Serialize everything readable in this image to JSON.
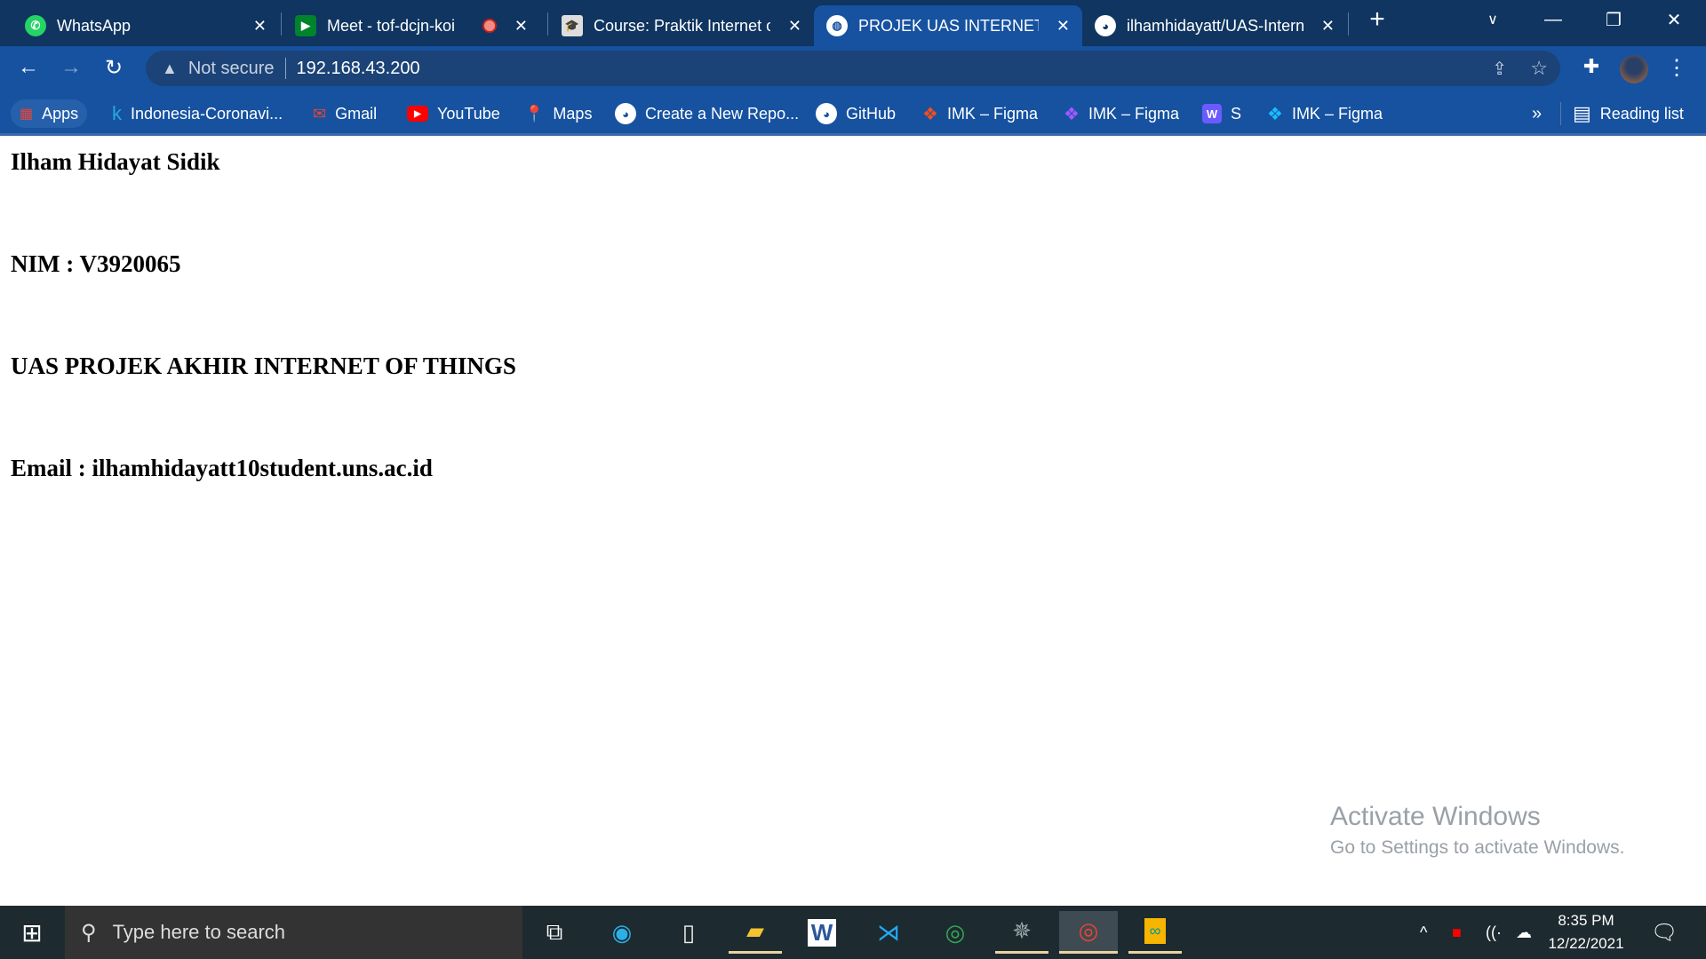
{
  "browser": {
    "tabs": [
      {
        "title": "WhatsApp",
        "icon": "whatsapp-icon",
        "active": false
      },
      {
        "title": "Meet - tof-dcjn-koi",
        "icon": "google-meet-icon",
        "active": false,
        "recording": true
      },
      {
        "title": "Course: Praktik Internet of",
        "icon": "moodle-course-icon",
        "active": false
      },
      {
        "title": "PROJEK UAS INTERNET OF",
        "icon": "globe-icon",
        "active": true
      },
      {
        "title": "ilhamhidayatt/UAS-Intern",
        "icon": "github-icon",
        "active": false
      }
    ],
    "close_glyph": "✕",
    "new_tab": "+",
    "security_label": "Not secure",
    "url": "192.168.43.200",
    "bookmarks": [
      {
        "label": "Apps",
        "icon": "apps-grid-icon"
      },
      {
        "label": "Indonesia-Coronavi...",
        "icon": "k-icon"
      },
      {
        "label": "Gmail",
        "icon": "gmail-icon"
      },
      {
        "label": "YouTube",
        "icon": "youtube-icon"
      },
      {
        "label": "Maps",
        "icon": "maps-icon"
      },
      {
        "label": "Create a New Repo...",
        "icon": "github-icon"
      },
      {
        "label": "GitHub",
        "icon": "github-icon"
      },
      {
        "label": "IMK – Figma",
        "icon": "figma-icon"
      },
      {
        "label": "IMK – Figma",
        "icon": "figma-icon"
      },
      {
        "label": "S",
        "icon": "w-icon"
      },
      {
        "label": "IMK – Figma",
        "icon": "figma-icon"
      }
    ],
    "more_bookmarks": "»",
    "reading_list": "Reading list"
  },
  "page": {
    "name": "Ilham Hidayat Sidik",
    "nim": "NIM : V3920065",
    "title": "UAS PROJEK AKHIR INTERNET OF THINGS",
    "email": "Email : ilhamhidayatt10student.uns.ac.id"
  },
  "watermark": {
    "line1": "Activate Windows",
    "line2": "Go to Settings to activate Windows."
  },
  "taskbar": {
    "search_placeholder": "Type here to search",
    "apps": [
      "task-view",
      "edge",
      "notepad",
      "file-explorer",
      "word",
      "vscode",
      "chrome",
      "app",
      "chrome-profile",
      "arduino"
    ],
    "time": "8:35 PM",
    "date": "12/22/2021"
  }
}
